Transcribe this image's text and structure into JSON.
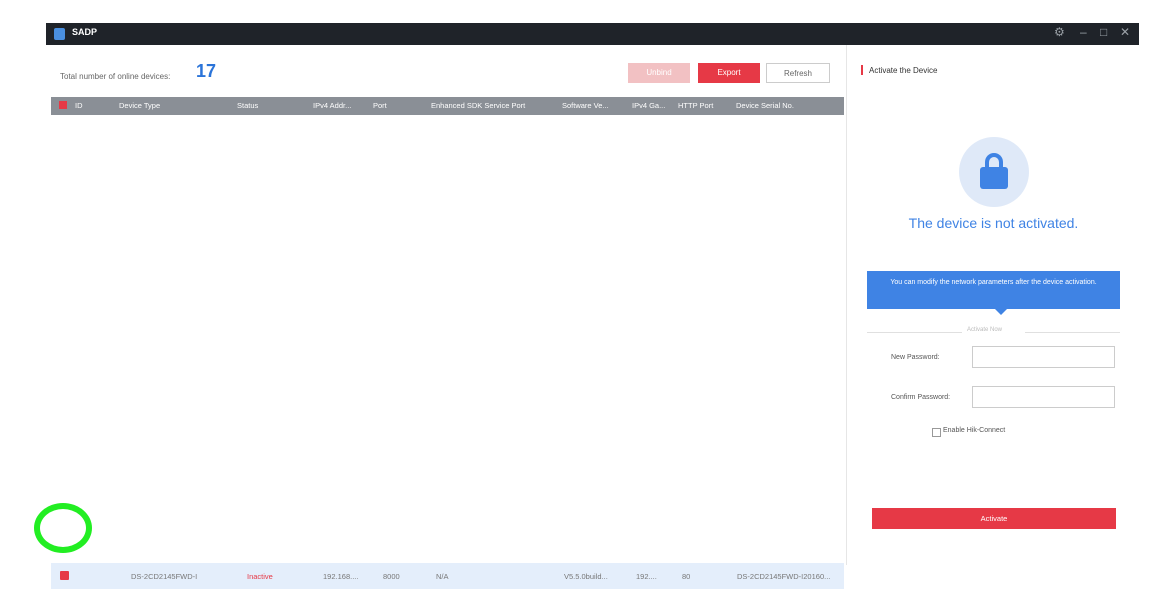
{
  "app": {
    "title": "SADP",
    "controls": [
      "⚙",
      "–",
      "□",
      "✕"
    ]
  },
  "summary": {
    "label": "Total number of online devices:",
    "count": "17"
  },
  "toolbar": {
    "unbind": "Unbind",
    "export": "Export",
    "refresh": "Refresh"
  },
  "table": {
    "headers": [
      "ID",
      "Device Type",
      "Status",
      "IPv4 Addr...",
      "Port",
      "Enhanced SDK Service Port",
      "Software Ve...",
      "IPv4 Ga...",
      "HTTP Port",
      "Device Serial No."
    ],
    "rows": [
      {
        "id": "",
        "device_type": "DS-2CD2145FWD-I",
        "status": "Inactive",
        "ipv4": "192.168....",
        "port": "8000",
        "sdk_port": "N/A",
        "software": "V5.5.0build...",
        "gateway": "192....",
        "http_port": "80",
        "serial": "DS-2CD2145FWD-I20160..."
      }
    ]
  },
  "panel": {
    "title": "Activate the Device",
    "status_text": "The device is not activated.",
    "tooltip": "You can modify the network parameters after the device activation.",
    "divider_label": "Activate Now",
    "new_password_label": "New Password:",
    "confirm_password_label": "Confirm Password:",
    "hik_connect_label": "Enable Hik-Connect",
    "activate_button": "Activate"
  },
  "colors": {
    "accent": "#e63946",
    "blue": "#3f83e4",
    "titlebar": "#1f2329",
    "header": "#8a8f96",
    "row_selected": "#e4eefb"
  }
}
